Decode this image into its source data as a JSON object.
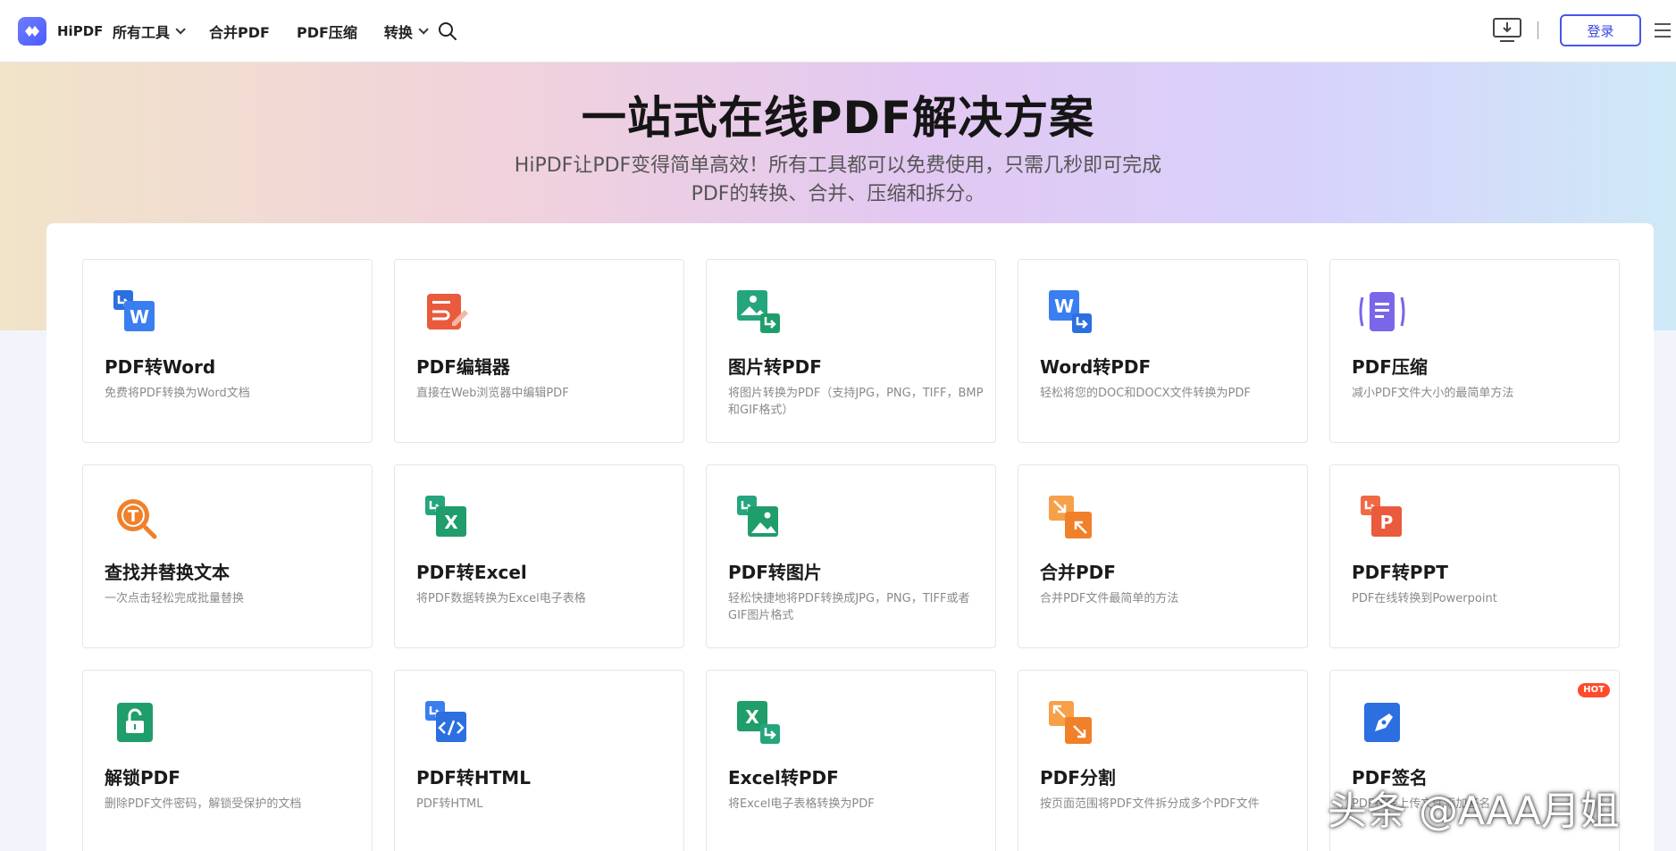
{
  "header": {
    "logo_text": "HiPDF",
    "nav": [
      {
        "label": "所有工具",
        "has_dropdown": true
      },
      {
        "label": "合并PDF",
        "has_dropdown": false
      },
      {
        "label": "PDF压缩",
        "has_dropdown": false
      },
      {
        "label": "转换",
        "has_dropdown": true
      }
    ],
    "login_label": "登录"
  },
  "hero": {
    "title": "一站式在线PDF解决方案",
    "subtitle_line1": "HiPDF让PDF变得简单高效！所有工具都可以免费使用，只需几秒即可完成",
    "subtitle_line2": "PDF的转换、合并、压缩和拆分。"
  },
  "tools": [
    {
      "title": "PDF转Word",
      "desc": "免费将PDF转换为Word文档",
      "icon": "pdf-to-word-icon"
    },
    {
      "title": "PDF编辑器",
      "desc": "直接在Web浏览器中编辑PDF",
      "icon": "pdf-editor-icon"
    },
    {
      "title": "图片转PDF",
      "desc": "将图片转换为PDF（支持JPG，PNG，TIFF，BMP和GIF格式）",
      "icon": "image-to-pdf-icon"
    },
    {
      "title": "Word转PDF",
      "desc": "轻松将您的DOC和DOCX文件转换为PDF",
      "icon": "word-to-pdf-icon"
    },
    {
      "title": "PDF压缩",
      "desc": "减小PDF文件大小的最简单方法",
      "icon": "pdf-compress-icon"
    },
    {
      "title": "查找并替换文本",
      "desc": "一次点击轻松完成批量替换",
      "icon": "find-replace-icon"
    },
    {
      "title": "PDF转Excel",
      "desc": "将PDF数据转换为Excel电子表格",
      "icon": "pdf-to-excel-icon"
    },
    {
      "title": "PDF转图片",
      "desc": "轻松快捷地将PDF转换成JPG，PNG，TIFF或者GIF图片格式",
      "icon": "pdf-to-image-icon"
    },
    {
      "title": "合并PDF",
      "desc": "合并PDF文件最简单的方法",
      "icon": "merge-pdf-icon"
    },
    {
      "title": "PDF转PPT",
      "desc": "PDF在线转换到Powerpoint",
      "icon": "pdf-to-ppt-icon"
    },
    {
      "title": "解锁PDF",
      "desc": "删除PDF文件密码，解锁受保护的文档",
      "icon": "unlock-pdf-icon"
    },
    {
      "title": "PDF转HTML",
      "desc": "PDF转HTML",
      "icon": "pdf-to-html-icon"
    },
    {
      "title": "Excel转PDF",
      "desc": "将Excel电子表格转换为PDF",
      "icon": "excel-to-pdf-icon"
    },
    {
      "title": "PDF分割",
      "desc": "按页面范围将PDF文件拆分成多个PDF文件",
      "icon": "split-pdf-icon"
    },
    {
      "title": "PDF签名",
      "desc": "PDF在线上传文件添加签名",
      "icon": "sign-pdf-icon",
      "badge": "HOT"
    }
  ],
  "watermark": "头条 @AAA月姐",
  "colors": {
    "accent": "#4a55e8",
    "word_blue": "#2b6fe0",
    "excel_green": "#1f9d6a",
    "orange": "#f0802a",
    "red": "#ea5a3c",
    "purple": "#7a66e8",
    "hot": "#ff4b2b"
  }
}
